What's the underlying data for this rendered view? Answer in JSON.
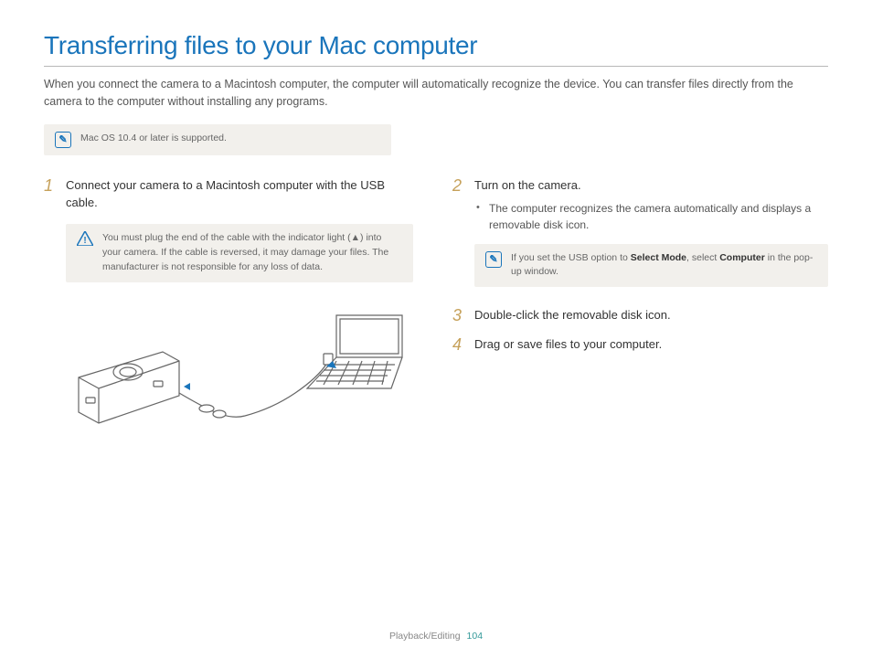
{
  "title": "Transferring files to your Mac computer",
  "intro": "When you connect the camera to a Macintosh computer, the computer will automatically recognize the device. You can transfer files directly from the camera to the computer without installing any programs.",
  "top_note": "Mac OS 10.4 or later is supported.",
  "left": {
    "step1_num": "1",
    "step1_text": "Connect your camera to a Macintosh computer with the USB cable.",
    "warn_pre": "You must plug the end of the cable with the indicator light (",
    "warn_post": ") into your camera. If the cable is reversed, it may damage your files. The manufacturer is not responsible for any loss of data."
  },
  "right": {
    "step2_num": "2",
    "step2_text": "Turn on the camera.",
    "step2_bullet": "The computer recognizes the camera automatically and displays a removable disk icon.",
    "note_pre": "If you set the USB option to ",
    "note_b1": "Select Mode",
    "note_mid": ", select ",
    "note_b2": "Computer",
    "note_post": " in the pop-up window.",
    "step3_num": "3",
    "step3_text": "Double-click the removable disk icon.",
    "step4_num": "4",
    "step4_text": "Drag or save files to your computer."
  },
  "footer_section": "Playback/Editing",
  "footer_page": "104"
}
